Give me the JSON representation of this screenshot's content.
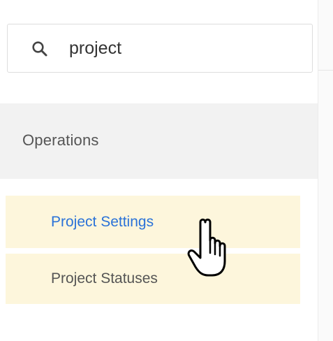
{
  "search": {
    "value": "project",
    "icon": "search-icon"
  },
  "sidebar": {
    "section_title": "Operations",
    "items": [
      {
        "label": "Project Settings",
        "state": "hovered"
      },
      {
        "label": "Project Statuses",
        "state": "normal"
      }
    ]
  },
  "cursor": {
    "icon": "hand-pointer-icon"
  },
  "colors": {
    "highlight_bg": "#fdf6dc",
    "link_blue": "#2a72d8",
    "section_bg": "#f2f2f2",
    "text_gray": "#555555"
  }
}
